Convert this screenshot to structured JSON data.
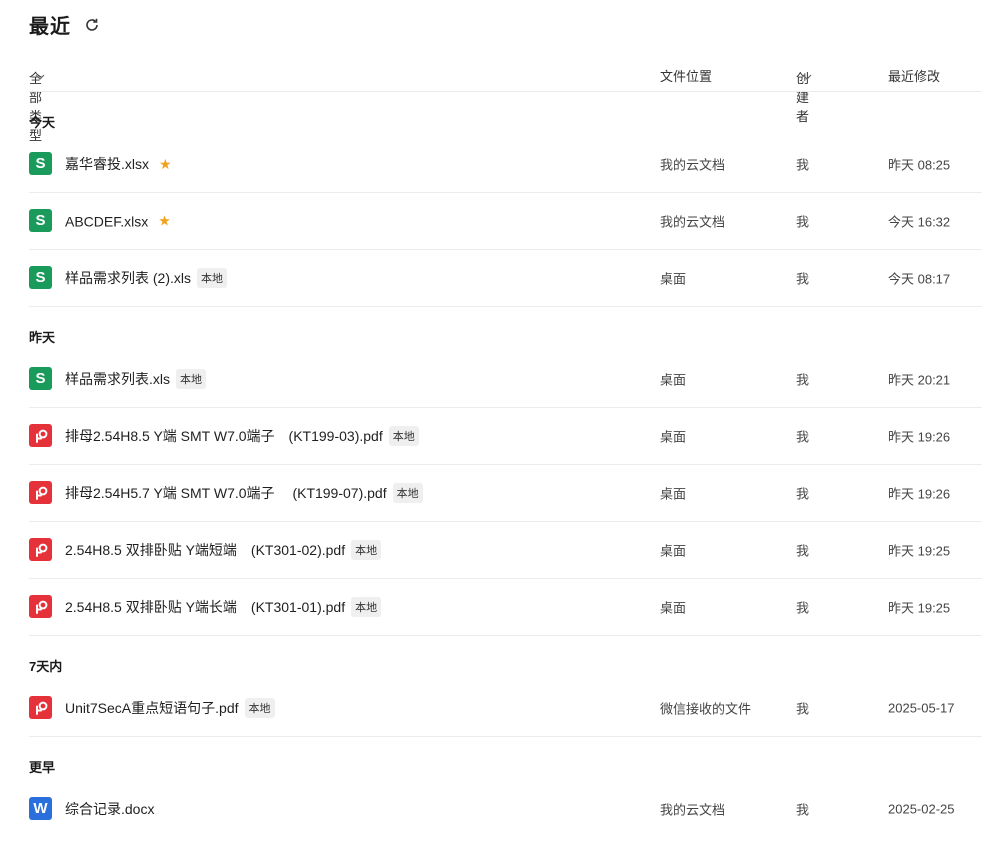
{
  "page": {
    "title": "最近"
  },
  "columns": {
    "type": "全部类型",
    "location": "文件位置",
    "creator": "创建者",
    "modified": "最近修改"
  },
  "sections": {
    "today": "今天",
    "yesterday": "昨天",
    "week": "7天内",
    "earlier": "更早"
  },
  "files": [
    {
      "icon": "S",
      "type": "spreadsheet",
      "name": "嘉华睿投.xlsx",
      "starred": true,
      "badge": "",
      "location": "我的云文档",
      "creator": "我",
      "modified": "昨天 08:25"
    },
    {
      "icon": "S",
      "type": "spreadsheet",
      "name": "ABCDEF.xlsx",
      "starred": true,
      "badge": "",
      "location": "我的云文档",
      "creator": "我",
      "modified": "今天 16:32"
    },
    {
      "icon": "S",
      "type": "spreadsheet",
      "name": "样品需求列表 (2).xls",
      "starred": false,
      "badge": "本地",
      "location": "桌面",
      "creator": "我",
      "modified": "今天 08:17"
    },
    {
      "icon": "S",
      "type": "spreadsheet",
      "name": "样品需求列表.xls",
      "starred": false,
      "badge": "本地",
      "location": "桌面",
      "creator": "我",
      "modified": "昨天 20:21"
    },
    {
      "icon": "pdf",
      "type": "pdf",
      "name": "排母2.54H8.5 Y端 SMT W7.0端子　(KT199-03).pdf",
      "starred": false,
      "badge": "本地",
      "location": "桌面",
      "creator": "我",
      "modified": "昨天 19:26"
    },
    {
      "icon": "pdf",
      "type": "pdf",
      "name": "排母2.54H5.7 Y端 SMT W7.0端子　 (KT199-07).pdf",
      "starred": false,
      "badge": "本地",
      "location": "桌面",
      "creator": "我",
      "modified": "昨天 19:26"
    },
    {
      "icon": "pdf",
      "type": "pdf",
      "name": "2.54H8.5 双排卧贴 Y端短端　(KT301-02).pdf",
      "starred": false,
      "badge": "本地",
      "location": "桌面",
      "creator": "我",
      "modified": "昨天 19:25"
    },
    {
      "icon": "pdf",
      "type": "pdf",
      "name": "2.54H8.5 双排卧贴 Y端长端　(KT301-01).pdf",
      "starred": false,
      "badge": "本地",
      "location": "桌面",
      "creator": "我",
      "modified": "昨天 19:25"
    },
    {
      "icon": "pdf",
      "type": "pdf",
      "name": "Unit7SecA重点短语句子.pdf",
      "starred": false,
      "badge": "本地",
      "location": "微信接收的文件",
      "creator": "我",
      "modified": "2025-05-17"
    },
    {
      "icon": "W",
      "type": "document",
      "name": "综合记录.docx",
      "starred": false,
      "badge": "",
      "location": "我的云文档",
      "creator": "我",
      "modified": "2025-02-25"
    }
  ],
  "colors": {
    "spreadsheet": "#1a9b5b",
    "pdf": "#e5313a",
    "document": "#2b6fdc",
    "star": "#f0a21b"
  }
}
